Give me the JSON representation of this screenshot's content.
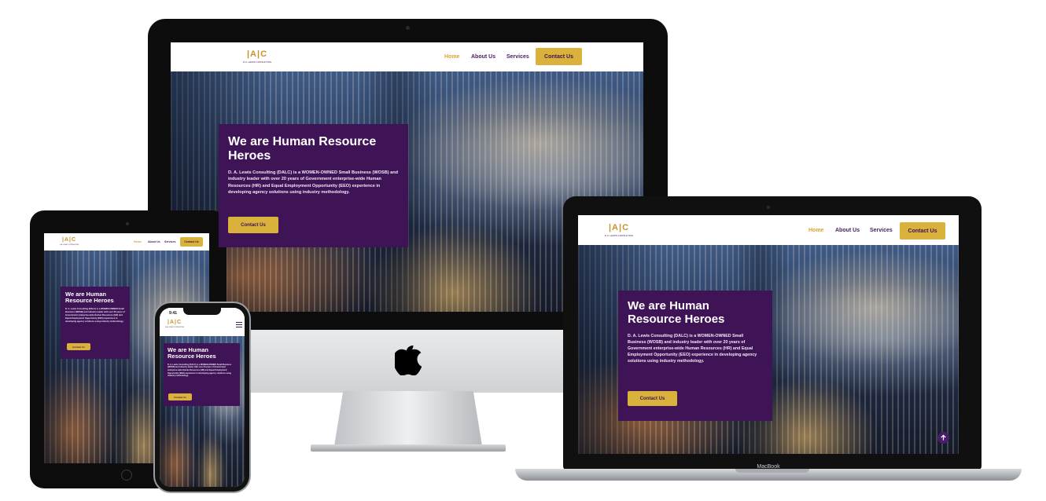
{
  "site": {
    "logo_mark": "|A|C",
    "logo_tagline": "D.A. LEWIS CONSULTING",
    "nav": {
      "home": "Home",
      "about": "About Us",
      "services": "Services",
      "contact": "Contact Us"
    },
    "hero": {
      "title": "We are Human Resource Heroes",
      "description": "D. A. Lewis Consulting (DALC) is a WOMEN-OWNED Small Business (WOSB) and industry leader with over 20 years of Government enterprise-wide Human Resources (HR) and Equal Employment Opportunity (EEO) experience in developing agency solutions using industry methodology.",
      "button": "Contact Us"
    }
  },
  "devices": {
    "laptop_label": "MacBook",
    "phone_time": "9:41"
  },
  "colors": {
    "purple": "#3f1456",
    "gold": "#d9b13b",
    "nav_active": "#d9a52e"
  },
  "icons": [
    "apple-logo-icon",
    "scroll-top-arrow-icon",
    "hamburger-menu-icon",
    "home-button-icon"
  ]
}
